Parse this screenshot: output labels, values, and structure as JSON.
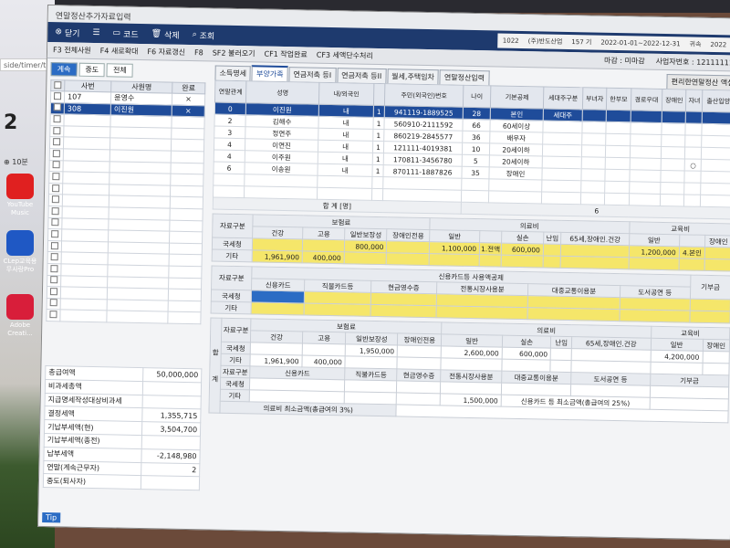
{
  "desktop": {
    "url_fragment": "side/timer/ti",
    "number_display": "2",
    "timer_button": "10분",
    "icons": [
      {
        "label": "YouTube\nMusic",
        "color": "#e02020"
      },
      {
        "label": "CLep교육용\n무사랑Pro",
        "color": "#1f58c4"
      },
      {
        "label": "Adobe\nCreati...",
        "color": "#d81e3a"
      }
    ]
  },
  "window": {
    "title": "연말정산추가자료입력"
  },
  "toolbar": {
    "close": "닫기",
    "code": "코드",
    "delete": "삭제",
    "search": "조회",
    "company_code": "1022",
    "company_name": "(주)반도산업",
    "period_label": "157 기",
    "period": "2022-01-01~2022-12-31",
    "tax_year_label": "귀속",
    "tax_year": "2022"
  },
  "toolbar2": {
    "items": [
      "F3 전체사원",
      "F4 새로확대",
      "F6 자료갱신",
      "F8"
    ],
    "right_items": [
      "SF2 불러오기",
      "CF1 작업완료",
      "CF3 세액단수처리"
    ],
    "closing_month_label": "마감",
    "closing_month_value": "미마감",
    "business_no_label": "사업자번호",
    "business_no": "12111111"
  },
  "left": {
    "subtabs": [
      "계속",
      "중도",
      "전체"
    ],
    "columns": [
      "사번",
      "사원명",
      "완료"
    ],
    "employees": [
      {
        "id": "107",
        "name": "윤영수",
        "done": "×"
      },
      {
        "id": "308",
        "name": "이진원",
        "done": "×"
      }
    ],
    "summary": [
      {
        "label": "총급여액",
        "value": "50,000,000"
      },
      {
        "label": "비과세총액",
        "value": ""
      },
      {
        "label": "지급명세작성대상비과세",
        "value": ""
      },
      {
        "label": "결정세액",
        "value": "1,355,715"
      },
      {
        "label": "기납부세액(현)",
        "value": "3,504,700"
      },
      {
        "label": "기납부세액(종전)",
        "value": ""
      },
      {
        "label": "납부세액",
        "value": "-2,148,980"
      },
      {
        "label": "연말(계속근무자)",
        "value": "2"
      },
      {
        "label": "중도(퇴사자)",
        "value": ""
      }
    ],
    "tip": "Tip"
  },
  "main": {
    "tabs": [
      "소득명세",
      "부양가족",
      "연금저축 등I",
      "연금저축 등II",
      "월세,주택임차",
      "연말정산입력"
    ],
    "right_button": "편리한연말정산 액셀",
    "dep_columns": [
      "연말관계",
      "성명",
      "내/외국인",
      "",
      "주민(외국인)번호",
      "나이",
      "기본공제",
      "세대주구분",
      "부녀자",
      "한부모",
      "경로우대",
      "장애인",
      "자녀",
      "출산입양"
    ],
    "dependents": [
      {
        "rel": "0",
        "name": "이진원",
        "nat": "내",
        "n": "1",
        "rrn": "941119-1889525",
        "age": "28",
        "basic": "본인",
        "head": "세대주",
        "c": ""
      },
      {
        "rel": "2",
        "name": "김해수",
        "nat": "내",
        "n": "1",
        "rrn": "560910-2111592",
        "age": "66",
        "basic": "60세이상",
        "head": "",
        "c": ""
      },
      {
        "rel": "3",
        "name": "정연주",
        "nat": "내",
        "n": "1",
        "rrn": "860219-2845577",
        "age": "36",
        "basic": "배우자",
        "head": "",
        "c": ""
      },
      {
        "rel": "4",
        "name": "이연진",
        "nat": "내",
        "n": "1",
        "rrn": "121111-4019381",
        "age": "10",
        "basic": "20세이하",
        "head": "",
        "c": ""
      },
      {
        "rel": "4",
        "name": "이주원",
        "nat": "내",
        "n": "1",
        "rrn": "170811-3456780",
        "age": "5",
        "basic": "20세이하",
        "head": "",
        "c": "○"
      },
      {
        "rel": "6",
        "name": "이송원",
        "nat": "내",
        "n": "1",
        "rrn": "870111-1887826",
        "age": "35",
        "basic": "장애인",
        "head": "",
        "c": ""
      }
    ],
    "total_label": "합 계 [명]",
    "total_count": "6",
    "g1_head": [
      "자료구분",
      "보험료",
      "의료비",
      "교육비"
    ],
    "g1_sub": [
      "건강",
      "고용",
      "일반보장성",
      "장애인전용",
      "일반",
      "실손",
      "난임",
      "65세,장애인.건강",
      "일반",
      "장애인"
    ],
    "g1_nts": [
      "국세청",
      "",
      "",
      "800,000",
      "",
      "1,100,000",
      "1.전액",
      "600,000",
      "",
      "",
      "1,200,000",
      "4.본인",
      ""
    ],
    "g1_etc": [
      "기타",
      "1,961,900",
      "400,000"
    ],
    "g2_head": [
      "자료구분",
      "신용카드등 사용액공제",
      "기부금"
    ],
    "g2_sub": [
      "신용카드",
      "직불카드등",
      "현금영수증",
      "전통시장사용분",
      "대중교통이용분",
      "도서공연 등"
    ],
    "g2_rows": [
      "국세청",
      "기타"
    ],
    "g3_side": [
      "합",
      "계"
    ],
    "g3_sub1": [
      "자료구분",
      "보험료",
      "의료비",
      "교육비"
    ],
    "g3_sub": [
      "건강",
      "고용",
      "일반보장성",
      "장애인전용",
      "일반",
      "실손",
      "난임",
      "65세,장애인.건강",
      "일반",
      "장애인"
    ],
    "g3_nts": [
      "국세청",
      "",
      "",
      "1,950,000",
      "",
      "2,600,000",
      "600,000",
      "",
      "",
      "4,200,000"
    ],
    "g3_etc": [
      "기타",
      "1,961,900",
      "400,000"
    ],
    "g4_sub": [
      "자료구분",
      "신용카드",
      "직불카드등",
      "현금영수증",
      "전통시장사용분",
      "대중교통이용분",
      "도서공연 등",
      "기부금"
    ],
    "g4_rows": [
      "국세청",
      "기타"
    ],
    "g5_label": "의료비 최소금액(총급여의 3%)",
    "g5_value": "1,500,000",
    "g5_label2": "신용카드 등 최소금액(총급여의 25%)"
  }
}
